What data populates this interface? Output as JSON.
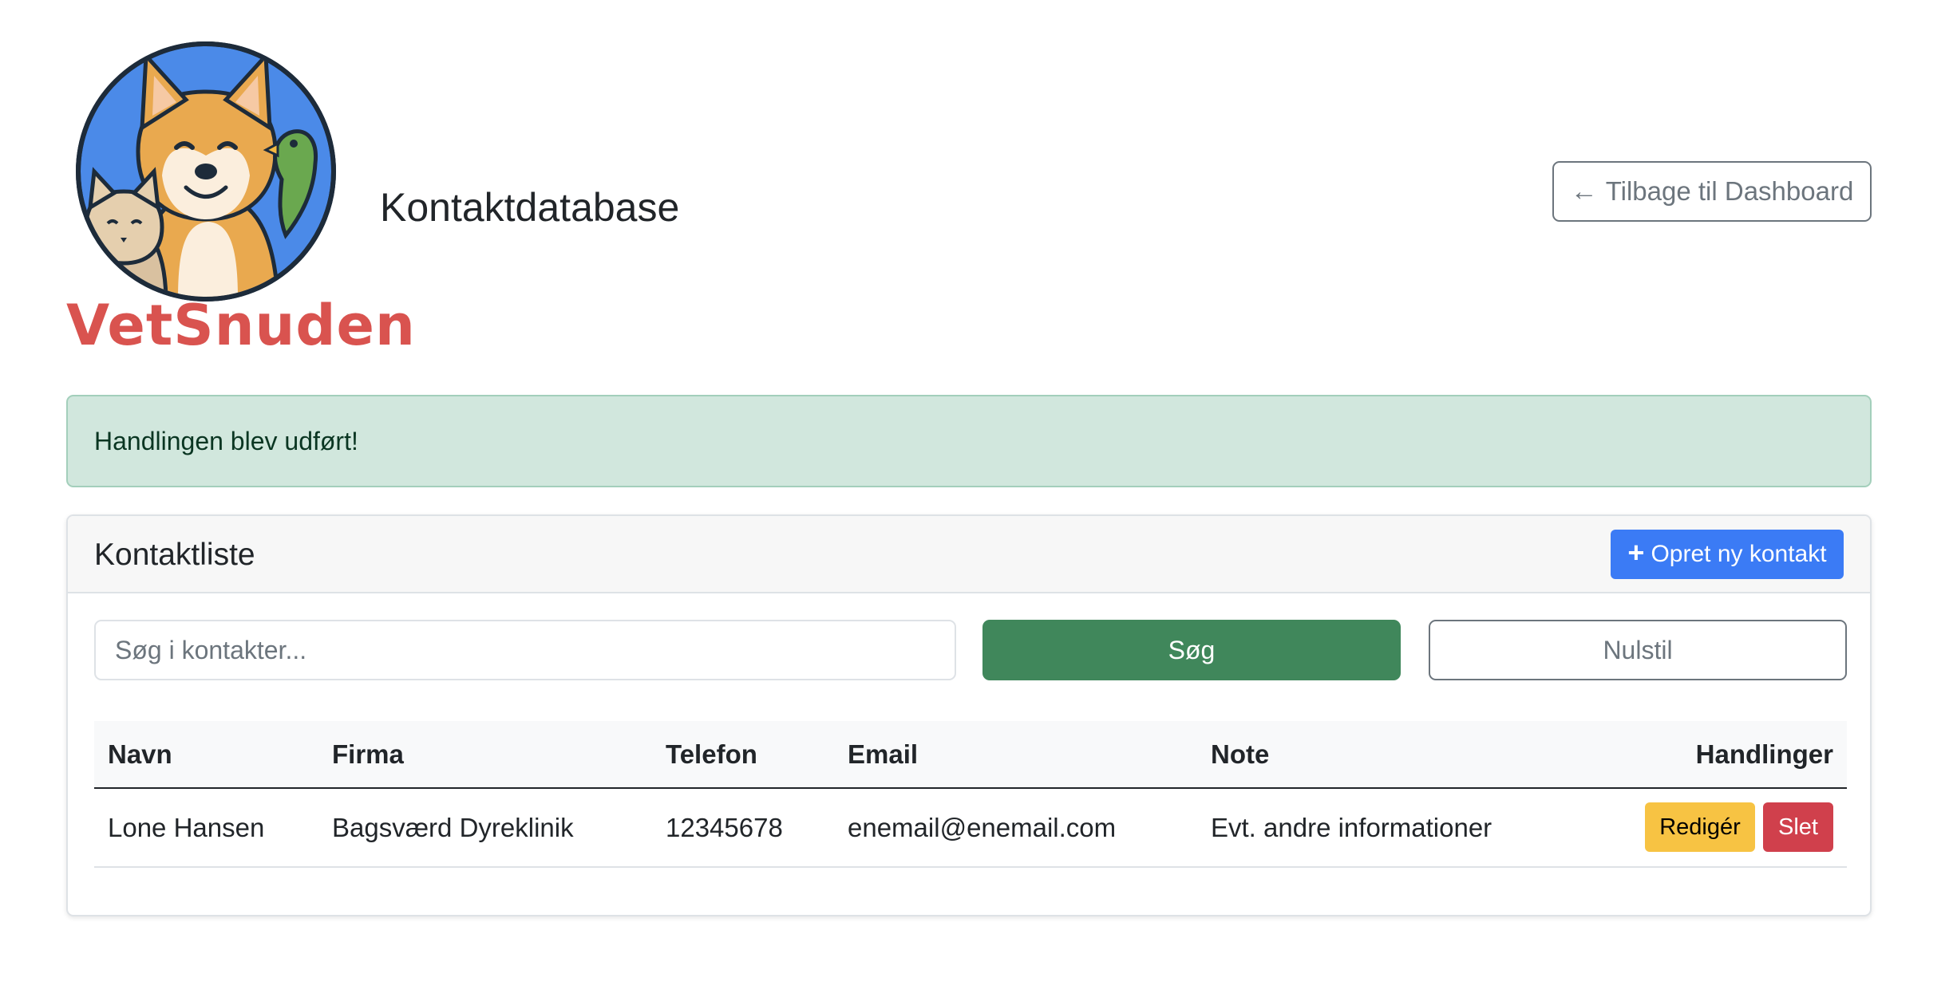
{
  "brand": {
    "logo_text": "VetSnuden"
  },
  "header": {
    "title": "Kontaktdatabase",
    "back_label": "Tilbage til Dashboard",
    "back_icon": "arrow-left-icon"
  },
  "alert": {
    "message": "Handlingen blev udført!"
  },
  "card": {
    "title": "Kontaktliste",
    "create_label": "Opret ny kontakt",
    "create_icon": "plus-icon"
  },
  "search": {
    "placeholder": "Søg i kontakter...",
    "value": "",
    "search_label": "Søg",
    "reset_label": "Nulstil"
  },
  "table": {
    "columns": {
      "name": "Navn",
      "company": "Firma",
      "phone": "Telefon",
      "email": "Email",
      "note": "Note",
      "actions": "Handlinger"
    },
    "rows": [
      {
        "name": "Lone Hansen",
        "company": "Bagsværd Dyreklinik",
        "phone": "12345678",
        "email": "enemail@enemail.com",
        "note": "Evt. andre informationer",
        "edit_label": "Redigér",
        "delete_label": "Slet"
      }
    ]
  },
  "colors": {
    "primary": "#3b7bf5",
    "success": "#40875b",
    "alert_bg": "#d1e7dd",
    "warning": "#f7c343",
    "danger": "#d0404c",
    "logo_text": "#d9534f",
    "logo_circle": "#4b8ae8"
  }
}
